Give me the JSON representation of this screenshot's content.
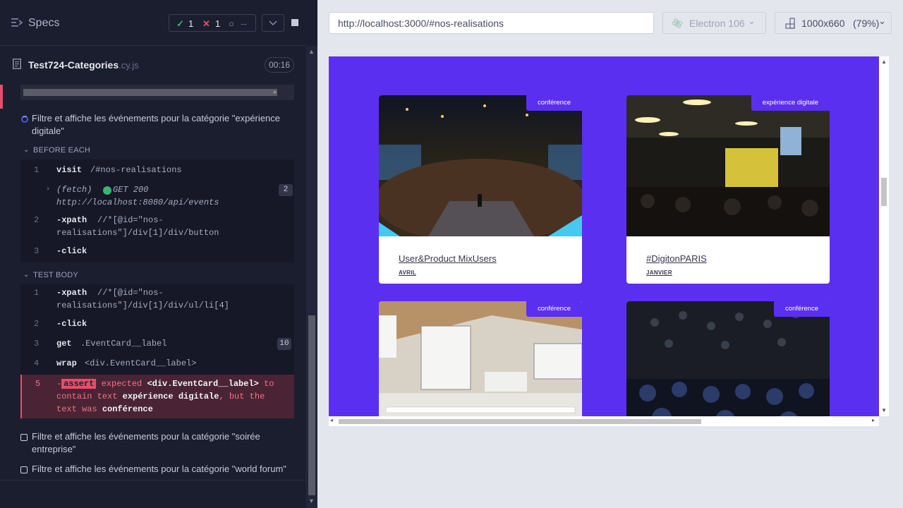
{
  "specs": {
    "title": "Specs",
    "passed": "1",
    "failed": "1",
    "pending": "--"
  },
  "file": {
    "name": "Test724-Categories",
    "ext": ".cy.js",
    "duration": "00:16"
  },
  "tests": [
    {
      "title": "Filtre et affiche les événements pour la catégorie \"expérience digitale\"",
      "state": "running"
    },
    {
      "title": "Filtre et affiche les événements pour la catégorie \"soirée entreprise\"",
      "state": "pending"
    },
    {
      "title": "Filtre et affiche les événements pour la catégorie \"world forum\"",
      "state": "pending"
    }
  ],
  "before_each": {
    "label": "BEFORE EACH",
    "commands": [
      {
        "num": "1",
        "name": "visit",
        "msg": "/#nos-realisations"
      },
      {
        "num": "",
        "name": "(fetch)",
        "status": "GET 200",
        "msg": "http://localhost:8080/api/events",
        "badge": "2"
      },
      {
        "num": "2",
        "name": "-xpath",
        "msg": "//*[@id=\"nos-",
        "msg2": "realisations\"]/div[1]/div/button"
      },
      {
        "num": "3",
        "name": "-click",
        "msg": ""
      }
    ]
  },
  "test_body": {
    "label": "TEST BODY",
    "commands": [
      {
        "num": "1",
        "name": "-xpath",
        "msg": "//*[@id=\"nos-",
        "msg2": "realisations\"]/div[1]/div/ul/li[4]"
      },
      {
        "num": "2",
        "name": "-click",
        "msg": ""
      },
      {
        "num": "3",
        "name": "get",
        "msg": ".EventCard__label",
        "badge": "10"
      },
      {
        "num": "4",
        "name": "wrap",
        "msg": "<div.EventCard__label>"
      },
      {
        "num": "5",
        "name": "-",
        "tag": "assert",
        "w1": "expected",
        "w2": "<div.EventCard__label>",
        "w3": "to",
        "w4": "contain text",
        "w5": "expérience digitale",
        "w6": ", but the",
        "w7": "text was",
        "w8": "conférence"
      }
    ]
  },
  "browser": {
    "url": "http://localhost:3000/#nos-realisations",
    "name": "Electron 106",
    "viewport": "1000x660",
    "scale": "(79%)"
  },
  "cards": [
    {
      "tag": "conférence",
      "title": "User&Product MixUsers",
      "month": "AVRIL"
    },
    {
      "tag": "expérience digitale",
      "title": "#DigitonPARIS",
      "month": "JANVIER"
    },
    {
      "tag": "conférence",
      "title": "",
      "month": ""
    },
    {
      "tag": "conférence",
      "title": "",
      "month": ""
    }
  ],
  "colors": {
    "accent": "#5b2ff0",
    "fail": "#e2506a",
    "pass": "#3cb371",
    "runner_bg": "#1b1e2e"
  }
}
